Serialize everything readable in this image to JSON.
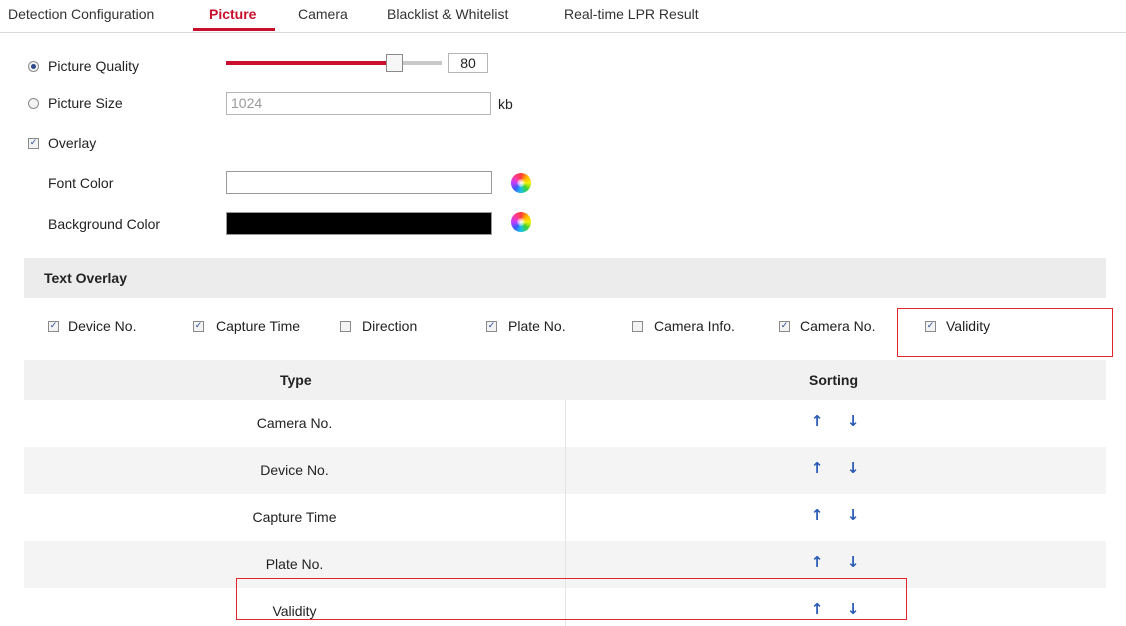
{
  "tabs": [
    "Detection Configuration",
    "Picture",
    "Camera",
    "Blacklist & Whitelist",
    "Real-time LPR Result"
  ],
  "active_tab": "Picture",
  "picture_quality": {
    "label": "Picture Quality",
    "value": "80",
    "level": 0.8,
    "selected": true
  },
  "picture_size": {
    "label": "Picture Size",
    "value": "1024",
    "unit": "kb",
    "selected": false
  },
  "overlay": {
    "label": "Overlay",
    "checked": true
  },
  "font_color": {
    "label": "Font Color",
    "value": "#ffffff"
  },
  "background_color": {
    "label": "Background Color",
    "value": "#000000"
  },
  "text_overlay": {
    "title": "Text Overlay",
    "options": [
      {
        "label": "Device No.",
        "checked": true
      },
      {
        "label": "Capture Time",
        "checked": true
      },
      {
        "label": "Direction",
        "checked": false
      },
      {
        "label": "Plate No.",
        "checked": true
      },
      {
        "label": "Camera Info.",
        "checked": false
      },
      {
        "label": "Camera No.",
        "checked": true
      },
      {
        "label": "Validity",
        "checked": true
      }
    ]
  },
  "table": {
    "headers": [
      "Type",
      "Sorting"
    ],
    "rows": [
      "Camera No.",
      "Device No.",
      "Capture Time",
      "Plate No.",
      "Validity"
    ]
  },
  "icons": {
    "up": "↑",
    "down": "↓",
    "check": "✓"
  },
  "colors": {
    "accent": "#c8102e",
    "arrow": "#2a5bb5",
    "highlight": "#e0262a"
  }
}
